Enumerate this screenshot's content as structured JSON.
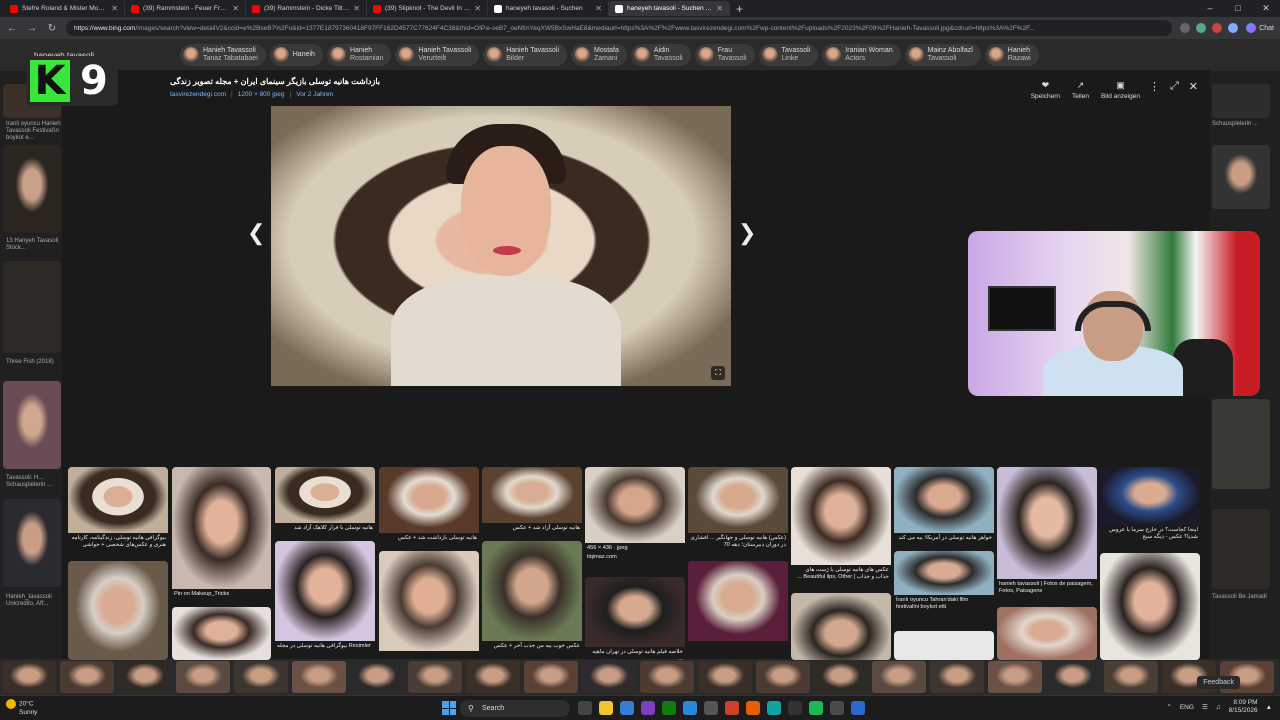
{
  "tabs": [
    {
      "label": "Stefre Roland & Mister Monj – Co",
      "color": "#ff0000"
    },
    {
      "label": "(39) Rammstein - Feuer Frei! (Offi",
      "color": "#ff0000"
    },
    {
      "label": "(39) Rammstein - Dicke Titten (Off",
      "color": "#ff0000"
    },
    {
      "label": "(39) Slipknot - The Devil In I [OFFI",
      "color": "#ff0000"
    },
    {
      "label": "haneyeh tavasoli - Suchen",
      "color": "#ffffff"
    },
    {
      "label": "haneyeh tavasoli - Suchen Bilder",
      "color": "#ffffff",
      "active": true
    }
  ],
  "url": {
    "host": "https://www.bing.com",
    "path": "/images/search?view=detailV2&ccid=e%2BseB7%2Fo&id=1377E18797360418F97FF162D4577C77624F4C38&thid=OIP.e-seB7_oeNfmYeqXW5BxSwHaE8&mediaurl=https%3A%2F%2Fwww.tasvirezendegi.com%2Fwp-content%2Fuploads%2F2023%2F09%2FHanieh-Tavassoli.jpg&cdnurl=https%3A%2F%2F..."
  },
  "chat_label": "Chat",
  "search_query": "haneyeh tavasoli",
  "chips": [
    {
      "l1": "Hanieh Tavassoli",
      "l2": "Tanaz Tabatabaei"
    },
    {
      "l1": "Haneih",
      "l2": ""
    },
    {
      "l1": "Hanieh",
      "l2": "Rostamian"
    },
    {
      "l1": "Hanieh Tavassoli",
      "l2": "Verurteilt"
    },
    {
      "l1": "Hanieh Tavassoli",
      "l2": "Bilder"
    },
    {
      "l1": "Mostafa",
      "l2": "Zamani"
    },
    {
      "l1": "Aidin",
      "l2": "Tavassoli"
    },
    {
      "l1": "Frau",
      "l2": "Tavassoli"
    },
    {
      "l1": "Tavassoli",
      "l2": "Linke"
    },
    {
      "l1": "Iranian Woman",
      "l2": "Actors"
    },
    {
      "l1": "Mainz Abolfazl",
      "l2": "Tavassoli"
    },
    {
      "l1": "Hanieh",
      "l2": "Razawi"
    }
  ],
  "overlay_logo": {
    "k": "K",
    "n": "9"
  },
  "modal": {
    "title": "بازداشت هانیه توسلی بازیگر سینمای ایران + مجله تصویر زندگی",
    "source": "tasvirezendegi.com",
    "size": "1200 × 800 jpeg",
    "age": "Vor 2 Jahren",
    "actions": [
      "Speichern",
      "Teilen",
      "Bild anzeigen"
    ]
  },
  "left_texts": [
    "Iranli oyuncu Hanieh Tavassoli Festival'in boykot e...",
    "13 Hanyeh Tavasoli Stock...",
    "Three Fish (2018)",
    "Tavassoli: H... Schauspielerin ...",
    "Hanieh_tavassoli Unicredito, Aff..."
  ],
  "right_texts": [
    "Schauspielerin ...",
    "Tavassoli Be Jamadi"
  ],
  "grid_captions": [
    "بیوگرافی هانیه توسلی، زندگینامه، کارنامه هنری و عکس‌های شخصی + حواشی",
    "Pin on Makeup_Tricks",
    "هانیه توسلی با فرار کلاهک آزاد شد",
    "هانیه توسلی بازداشت شد + عکس",
    "هانیه توسلی آزاد شد + عکس",
    "456 × 436 · jpeg",
    "(عکس) هانیه توسلی و جهانگیر ... افشاری در دوران دبیرستان؛ دهه 70",
    "عکس های هانیه توسلی با ژست های جذاب و جذاب | Beautiful lips, Other ...",
    "خواهر هانیه توسلی در آمریکا؛ بیه می کند",
    "hanieh tavassoli | Fotos de paisagem, Fotos, Paisagens",
    "اینجا کجاست؟ در خارج سرما یا عروس شدیا؟ عکس - دیگه سیج",
    "بیوگرافی هانیه توسلی در مجله Resimler",
    "عکس خوب بیه من جذب آخر + عکس",
    "İranlı oyuncu Tahran'daki film festivalini boykot etti",
    "خلاصه فیلم هانیه توسلی در تهران ماهیه ..."
  ],
  "grid_source_label": "tiqimaz.com",
  "taskbar": {
    "weather_temp": "20°C",
    "weather_desc": "Sunny",
    "search": "Search",
    "lang": "ENG",
    "time": "8:09 PM",
    "date": "8/15/2026",
    "feedback": "Feedback"
  }
}
